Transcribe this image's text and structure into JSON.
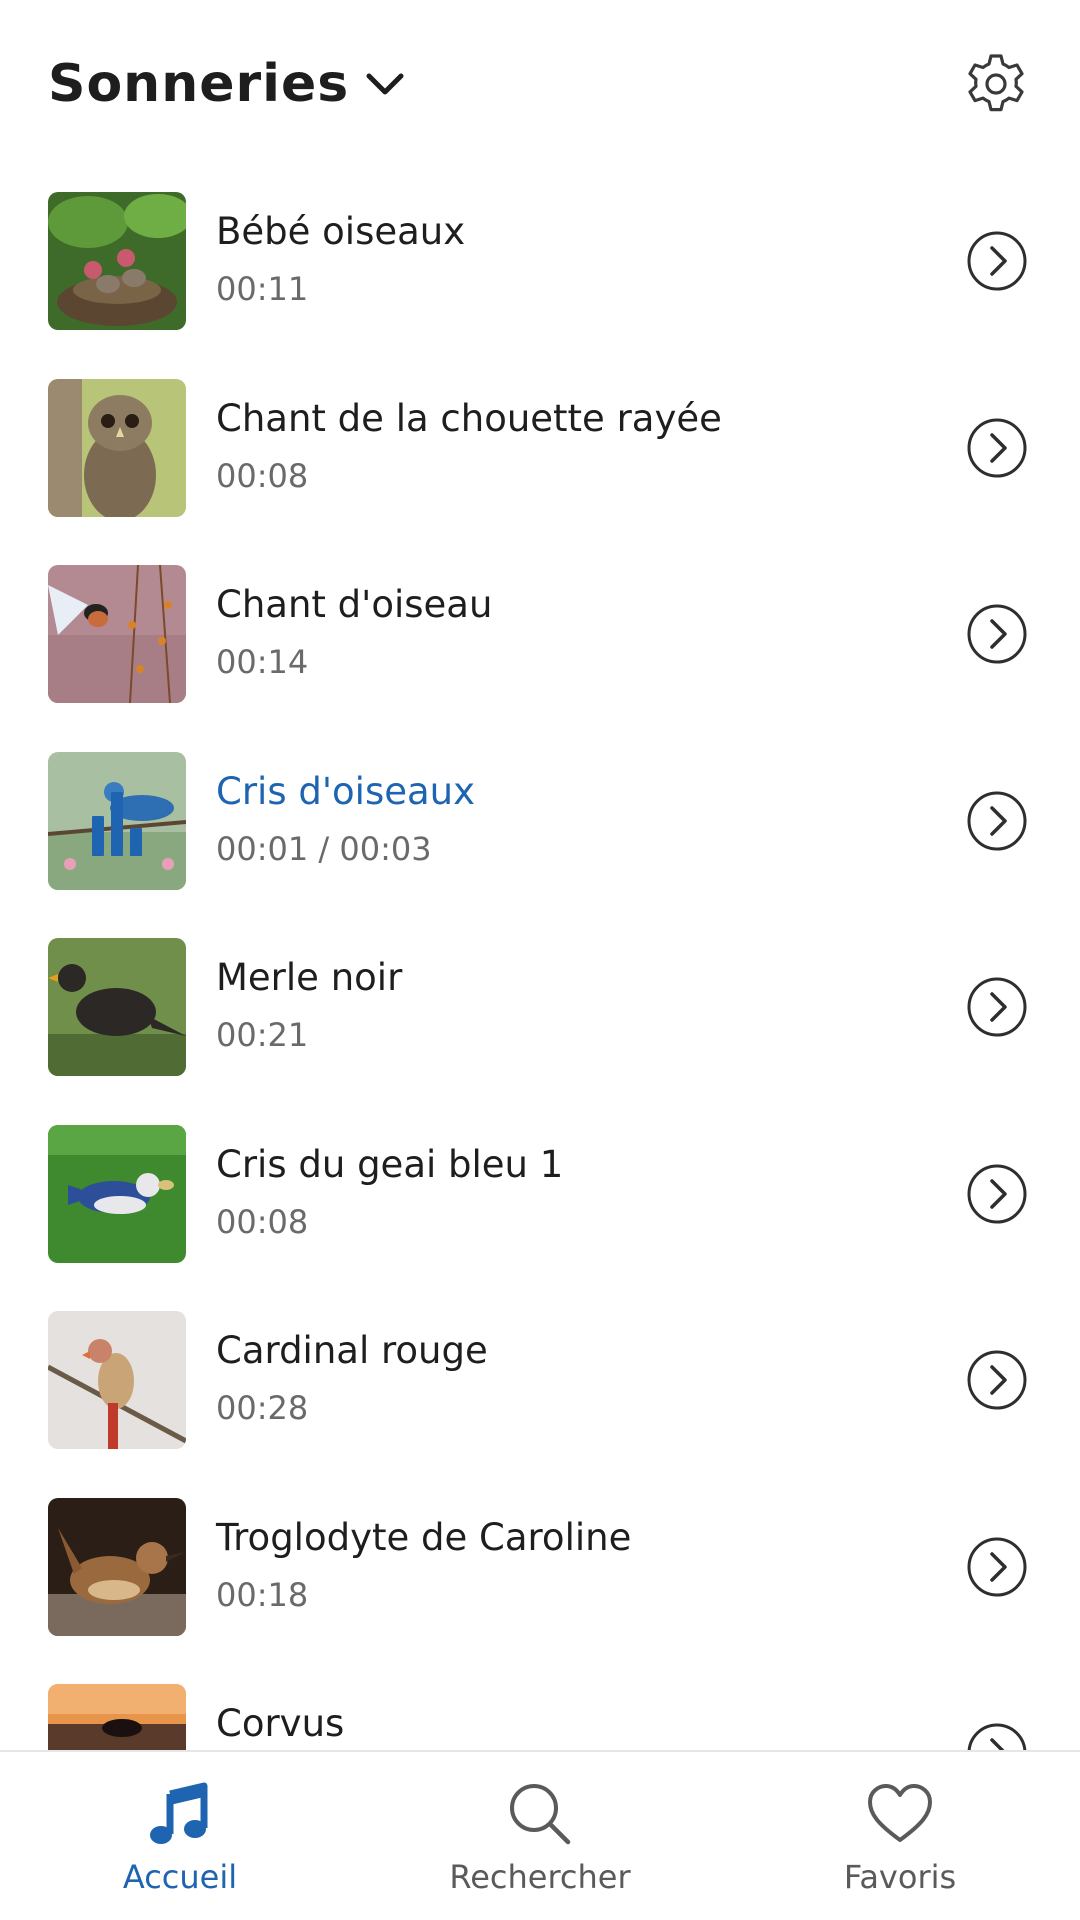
{
  "header": {
    "title": "Sonneries",
    "dropdown_icon": "chevron-down-icon",
    "settings_icon": "gear-icon"
  },
  "ringtones": [
    {
      "title": "Bébé oiseaux",
      "duration": "00:11",
      "thumb": "baby-birds-nest-photo",
      "active": false
    },
    {
      "title": "Chant de la chouette rayée",
      "duration": "00:08",
      "thumb": "barred-owl-photo",
      "active": false
    },
    {
      "title": "Chant d'oiseau",
      "duration": "00:14",
      "thumb": "hummingbird-branch-photo",
      "active": false
    },
    {
      "title": "Cris d'oiseaux",
      "duration": "00:01 / 00:03",
      "thumb": "blue-bird-branch-photo",
      "active": true
    },
    {
      "title": "Merle noir",
      "duration": "00:21",
      "thumb": "blackbird-grass-photo",
      "active": false
    },
    {
      "title": "Cris du geai bleu 1",
      "duration": "00:08",
      "thumb": "blue-jay-grass-photo",
      "active": false
    },
    {
      "title": "Cardinal rouge",
      "duration": "00:28",
      "thumb": "cardinal-branch-photo",
      "active": false
    },
    {
      "title": "Troglodyte de Caroline",
      "duration": "00:18",
      "thumb": "carolina-wren-photo",
      "active": false
    },
    {
      "title": "Corvus",
      "duration": "",
      "thumb": "crow-sunset-photo",
      "active": false
    }
  ],
  "nav": [
    {
      "label": "Accueil",
      "icon": "music-note-icon",
      "active": true
    },
    {
      "label": "Rechercher",
      "icon": "search-icon",
      "active": false
    },
    {
      "label": "Favoris",
      "icon": "heart-icon",
      "active": false
    }
  ],
  "colors": {
    "accent": "#1e64b0",
    "text": "#1e1e1e",
    "subtext": "#6a6a6a"
  }
}
